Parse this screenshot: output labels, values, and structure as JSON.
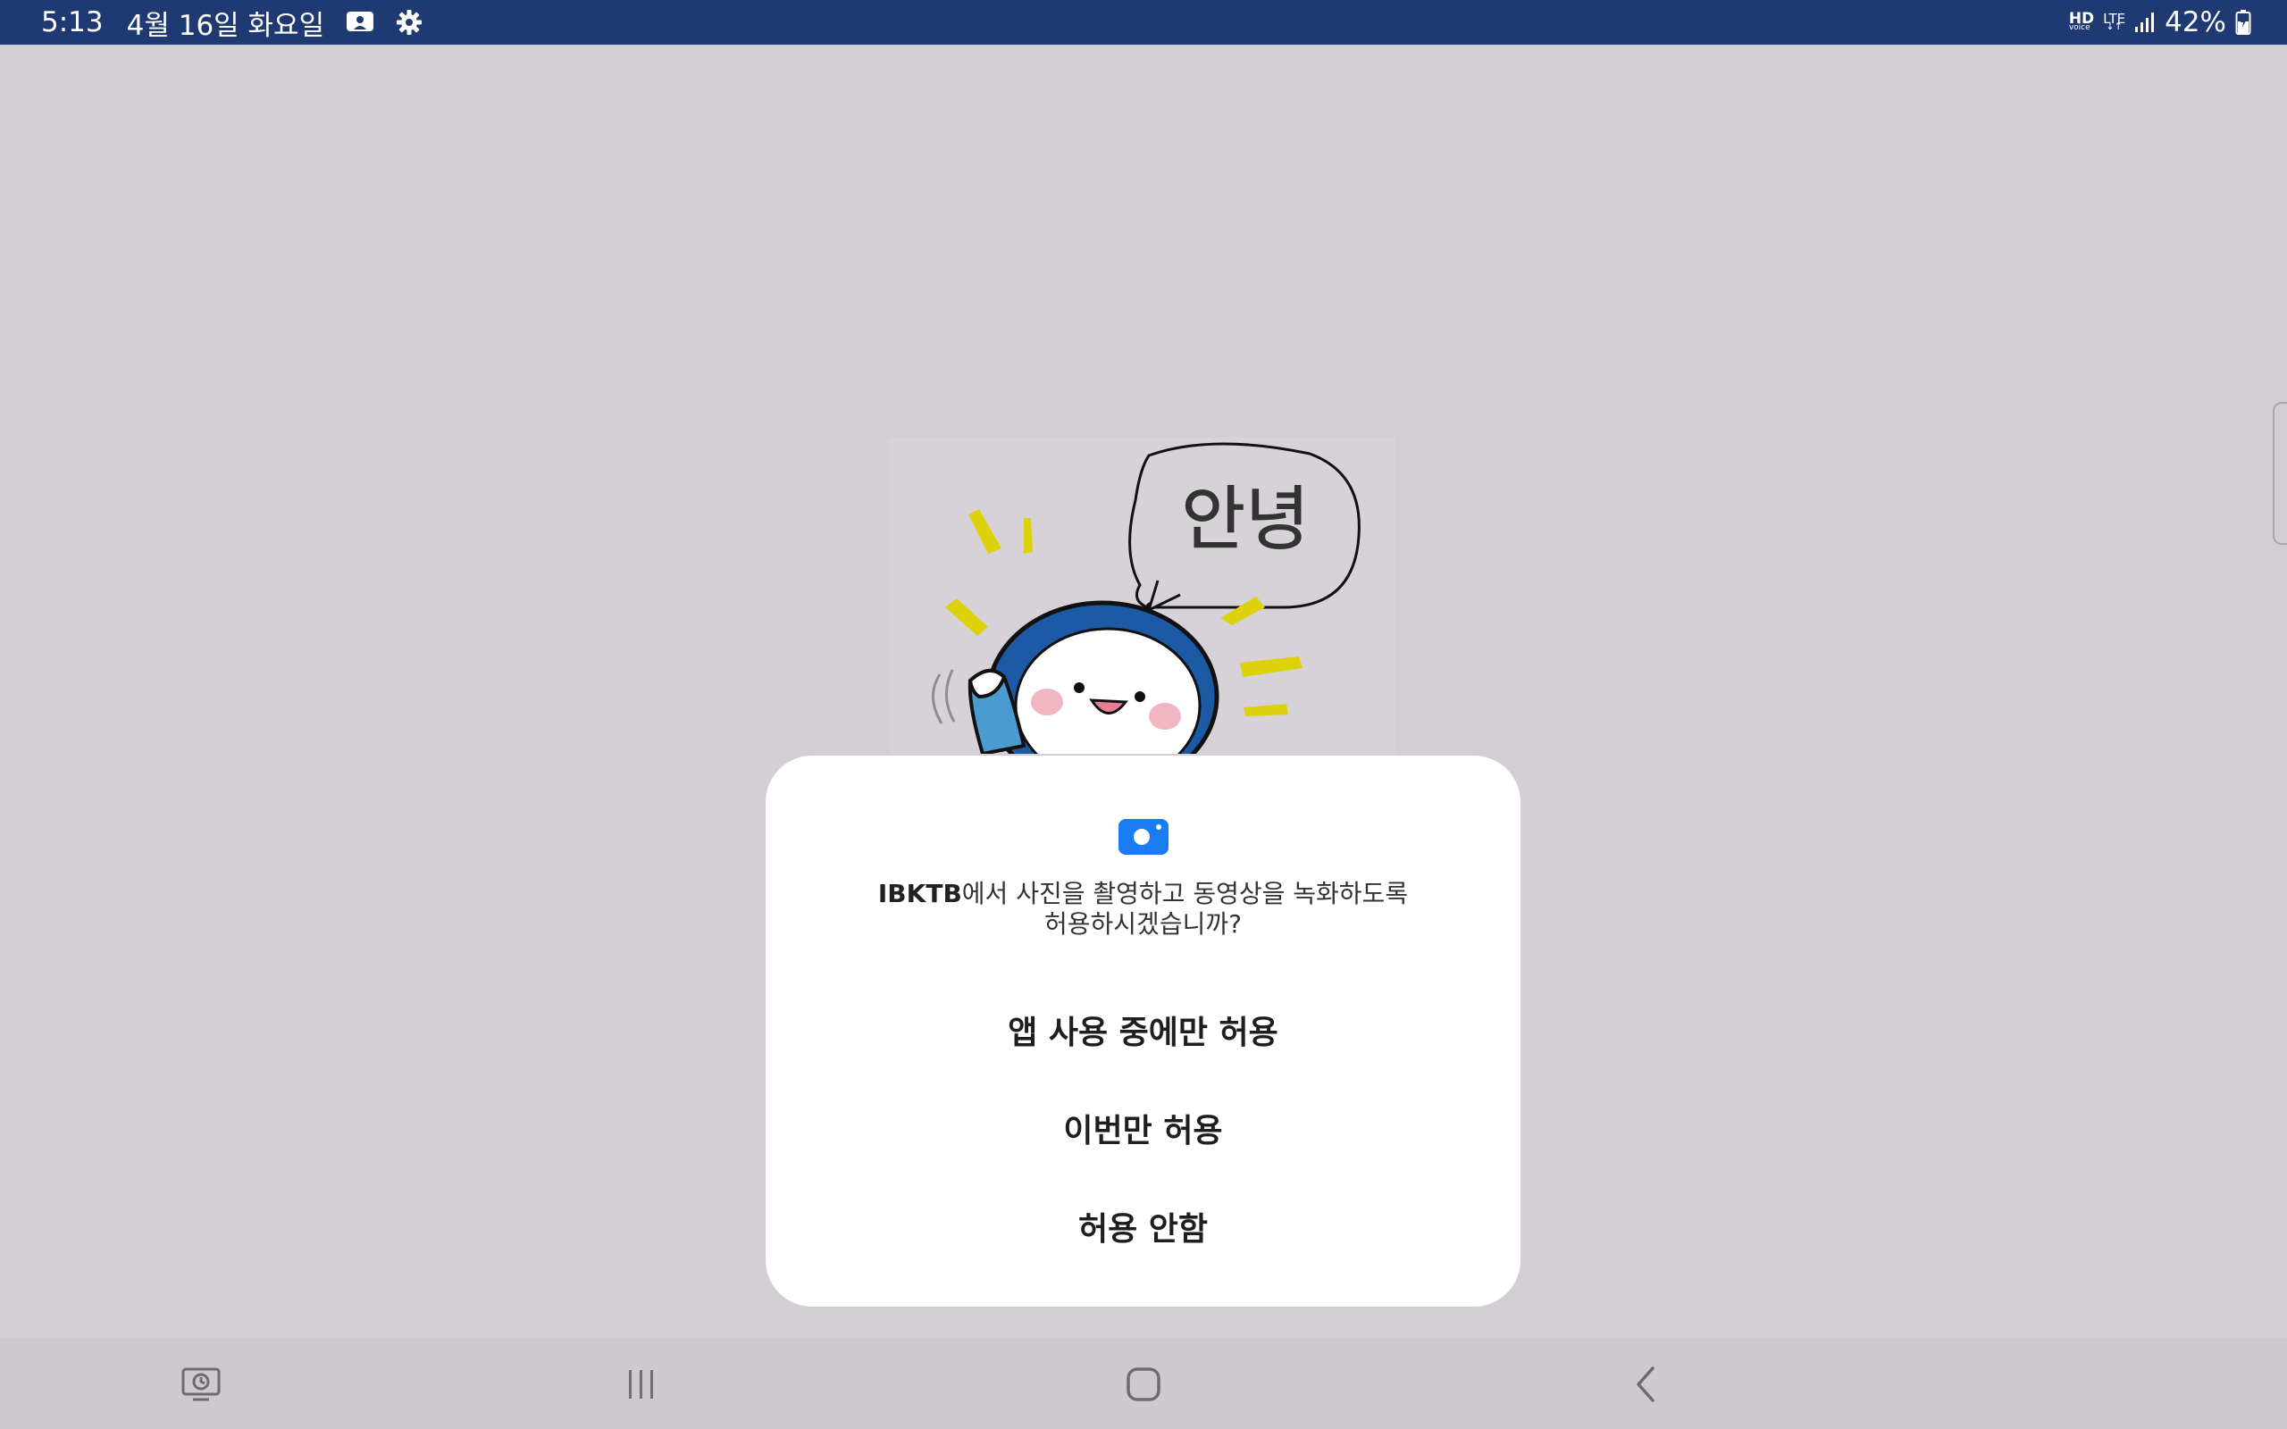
{
  "status_bar": {
    "time": "5:13",
    "date": "4월 16일 화요일",
    "left_icons": [
      "screen-recorder-icon",
      "settings-gear-icon"
    ],
    "hd_label": "HD",
    "hd_sub": "voice",
    "network": "LTE",
    "battery": "42%"
  },
  "illustration": {
    "speech_text": "안녕"
  },
  "dialog": {
    "icon": "camera-icon",
    "app_name": "IBKTB",
    "message_rest": "에서 사진을 촬영하고 동영상을 녹화하도록",
    "message_line2": "허용하시겠습니까?",
    "buttons": {
      "allow_while_using": "앱 사용 중에만 허용",
      "allow_once": "이번만 허용",
      "deny": "허용 안함"
    }
  },
  "nav_bar": {
    "buttons": [
      "recent-apps-screenshot-icon",
      "recents-icon",
      "home-icon",
      "back-icon"
    ]
  },
  "colors": {
    "status_bar": "#1f3a73",
    "background_scrim": "#d3ced4",
    "dialog_bg": "#ffffff",
    "camera_accent": "#1a7cf2",
    "mascot_blue": "#1d5aa6",
    "spark_yellow": "#ddd10c"
  }
}
